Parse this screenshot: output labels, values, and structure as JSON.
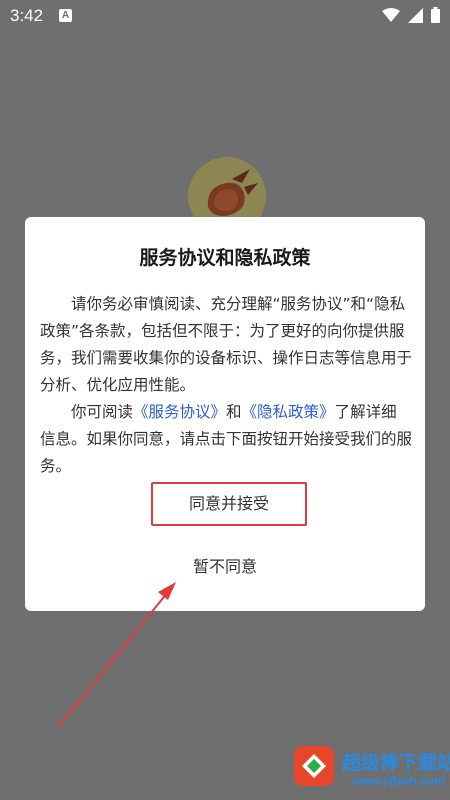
{
  "status_bar": {
    "time": "3:42",
    "notification_badge": "A",
    "icons": [
      "wifi-icon",
      "signal-icon",
      "battery-icon"
    ]
  },
  "dialog": {
    "title": "服务协议和隐私政策",
    "para1": "请你务必审慎阅读、充分理解“服务协议”和“隐私政策”各条款，包括但不限于：为了更好的向你提供服务，我们需要收集你的设备标识、操作日志等信息用于分析、优化应用性能。",
    "para2_prefix": "你可阅读",
    "service_agreement_link": "《服务协议》",
    "para2_and": "和",
    "privacy_policy_link": "《隐私政策》",
    "para2_suffix": "了解详细信息。如果你同意，请点击下面按钮开始接受我们的服务。",
    "agree_label": "同意并接受",
    "disagree_label": "暂不同意"
  },
  "watermark": {
    "name": "超级棒下载站",
    "url": "www.cjbwh.com"
  },
  "colors": {
    "overlay": "#6f6f6f",
    "link": "#2f5fd0",
    "highlight": "#e33a3a",
    "watermark": "#2a8ae0"
  }
}
